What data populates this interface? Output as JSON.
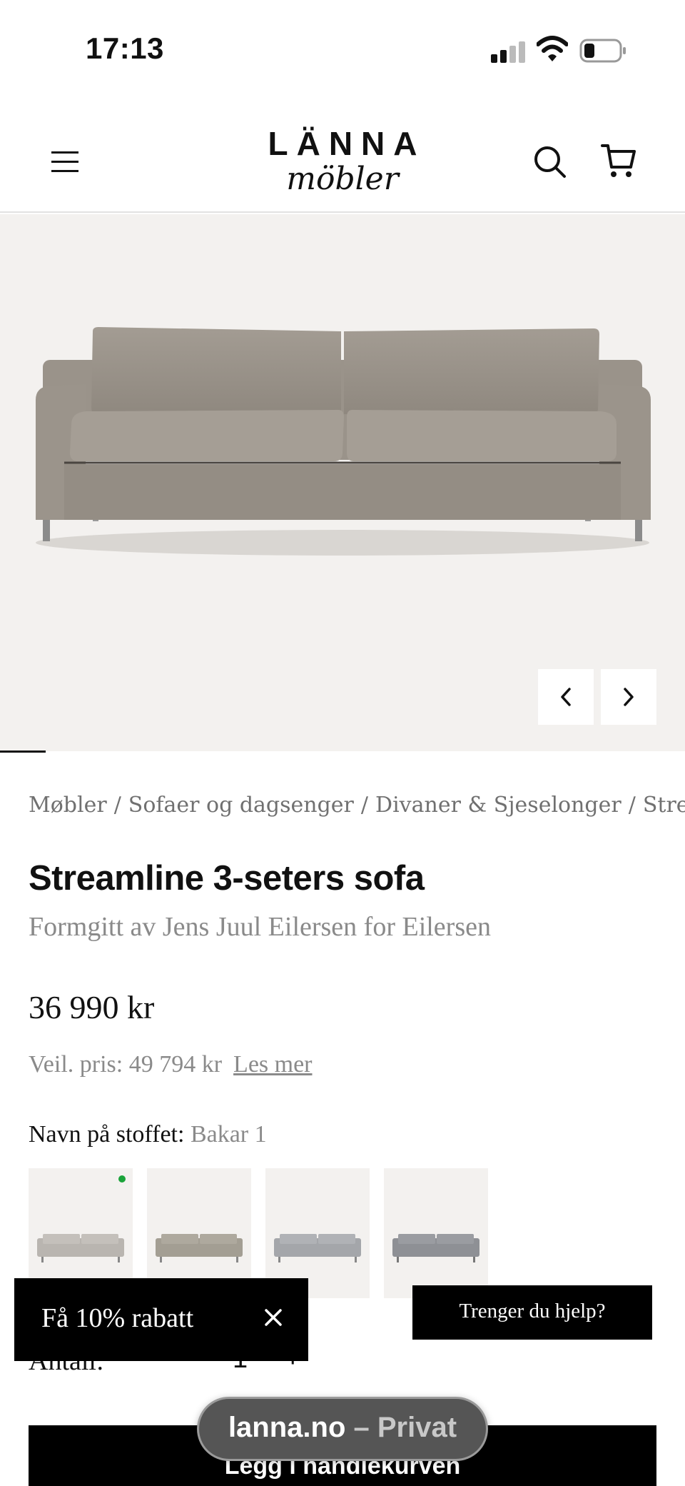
{
  "status_bar": {
    "time": "17:13"
  },
  "header": {
    "logo_top": "LÄNNA",
    "logo_bottom": "möbler"
  },
  "breadcrumb": [
    "Møbler",
    "Sofaer og dagsenger",
    "Divaner & Sjeselonger",
    "Strea"
  ],
  "product": {
    "title": "Streamline 3-seters sofa",
    "designer": "Formgitt av Jens Juul Eilersen for Eilersen",
    "price": "36 990 kr",
    "rrp": "Veil. pris: 49 794 kr",
    "read_more": "Les mer",
    "fabric_label": "Navn på stoffet:",
    "fabric_value": "Bakar 1",
    "quantity_label": "Antall:",
    "quantity_minus": "−",
    "quantity_value": "1",
    "quantity_plus": "+",
    "add_to_cart": "Legg i handlekurven"
  },
  "swatches": [
    {
      "color": "#b9b5b0",
      "selected": true
    },
    {
      "color": "#a39e93",
      "selected": false
    },
    {
      "color": "#a4a6aa",
      "selected": false
    },
    {
      "color": "#8e9095",
      "selected": false
    }
  ],
  "discount_banner": {
    "text": "Få 10% rabatt"
  },
  "help_button": {
    "text": "Trenger du hjelp?"
  },
  "url_pill": {
    "domain": "lanna.no",
    "separator": " – ",
    "mode": "Privat"
  },
  "colors": {
    "accent": "#000000",
    "hero_bg": "#f3f1ef",
    "muted_text": "#8a8a8a",
    "selected_dot": "#1aa33a"
  }
}
